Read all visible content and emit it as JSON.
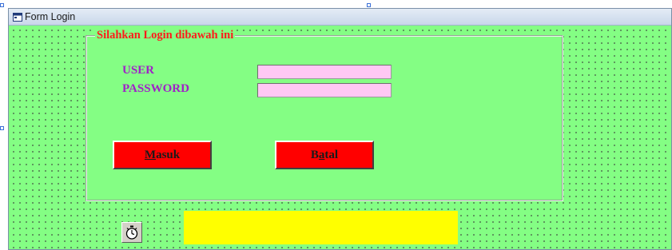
{
  "window": {
    "title": "Form Login",
    "background_color": "#84fe84",
    "icon": "form-icon"
  },
  "login_frame": {
    "caption": "Silahkan Login dibawah ini",
    "caption_color": "#ff1a1a"
  },
  "fields": {
    "user": {
      "label": "USER",
      "value": ""
    },
    "password": {
      "label": "PASSWORD",
      "value": ""
    },
    "label_color": "#a020c8",
    "input_background": "#ffc8f4"
  },
  "buttons": {
    "masuk": {
      "hotkey": "M",
      "rest": "asuk"
    },
    "batal": {
      "lead": "B",
      "hotkey": "a",
      "rest": "tal"
    },
    "color": "#ff0000"
  },
  "timer": {
    "icon": "stopwatch-icon"
  },
  "status_panel": {
    "text": "",
    "color": "#ffff00"
  }
}
